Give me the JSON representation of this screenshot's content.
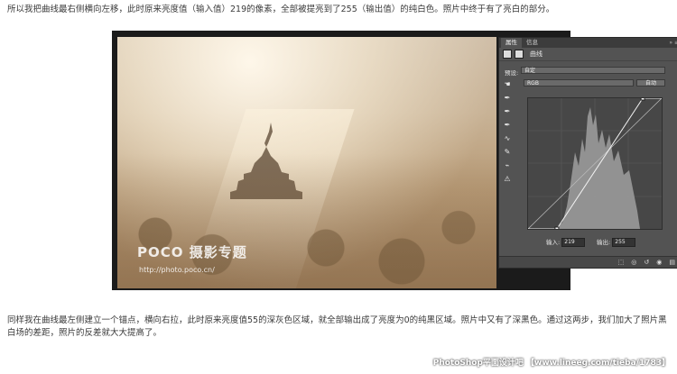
{
  "text": {
    "para1": "所以我把曲线最右侧横向左移，此时原来亮度值（输入值）219的像素，全部被提亮到了255（输出值）的纯白色。照片中终于有了亮白的部分。",
    "para2": "同样我在曲线最左侧建立一个锚点，横向右拉，此时原来亮度值55的深灰色区域，就全部输出成了亮度为0的纯黑区域。照片中又有了深黑色。通过这两步，我们加大了照片黑白场的差距，照片的反差就大大提高了。"
  },
  "photo": {
    "logo": "POCO 摄影专题",
    "logo_url": "http://photo.poco.cn/"
  },
  "panel": {
    "tabs": [
      "属性",
      "信息"
    ],
    "tab_controls": "» ≡",
    "title": "曲线",
    "preset_label": "预设:",
    "preset_value": "自定",
    "channel_value": "RGB",
    "auto_button": "自动",
    "input_label": "输入:",
    "input_value": "219",
    "output_label": "输出:",
    "output_value": "255",
    "curve_points": [
      [
        55,
        0
      ],
      [
        219,
        255
      ]
    ],
    "tools": [
      "hand-icon",
      "eyedropper-icon",
      "eyedropper-icon",
      "eyedropper-icon",
      "curve-icon",
      "pencil-icon",
      "smooth-icon",
      "warning-icon"
    ]
  },
  "footer": {
    "watermark": "PhotoShop平面设计吧 【www.lineeg.com/tieba/1783】"
  }
}
